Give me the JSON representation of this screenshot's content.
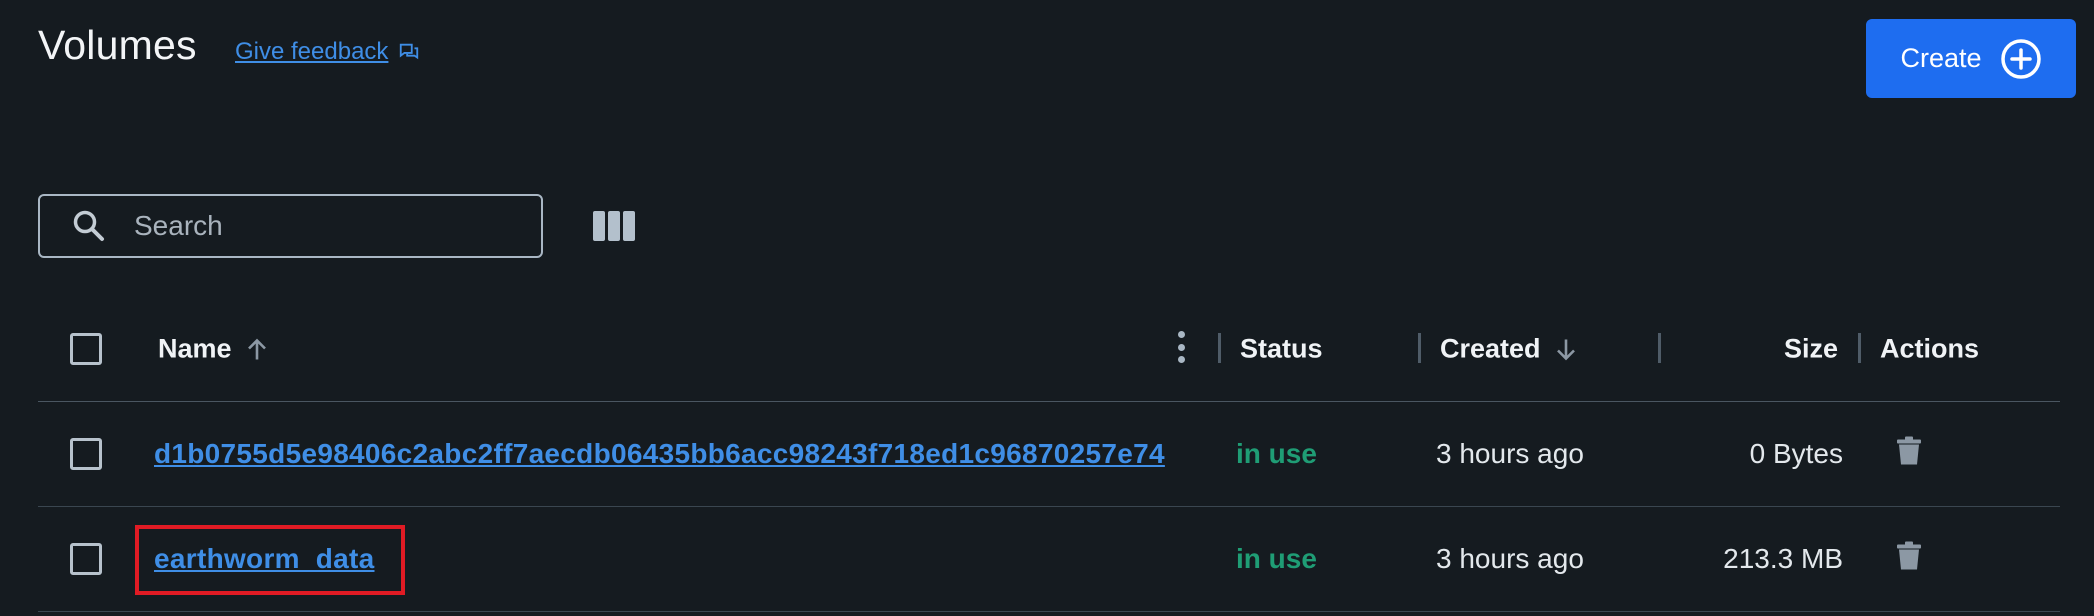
{
  "header": {
    "title": "Volumes",
    "feedback_label": "Give feedback",
    "create_label": "Create"
  },
  "search": {
    "placeholder": "Search",
    "value": ""
  },
  "table": {
    "columns": {
      "name": "Name",
      "status": "Status",
      "created": "Created",
      "size": "Size",
      "actions": "Actions"
    },
    "sort": {
      "name": "ascending",
      "created": "descending"
    },
    "rows": [
      {
        "name": "d1b0755d5e98406c2abc2ff7aecdb06435bb6acc98243f718ed1c96870257e74",
        "status": "in use",
        "created": "3 hours ago",
        "size": "0 Bytes"
      },
      {
        "name": "earthworm_data",
        "status": "in use",
        "created": "3 hours ago",
        "size": "213.3 MB"
      }
    ]
  },
  "colors": {
    "background": "#151b20",
    "accent": "#1e6df0",
    "link": "#3f8ee6",
    "status_in_use": "#1f9d75",
    "highlight": "#e01b24"
  },
  "icons": [
    "feedback-icon",
    "add-circle-icon",
    "search-icon",
    "columns-icon",
    "sort-up-icon",
    "sort-down-icon",
    "kebab-menu-icon",
    "trash-icon"
  ]
}
